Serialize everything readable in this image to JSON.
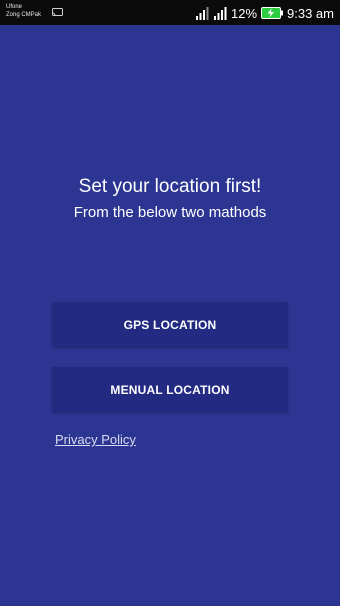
{
  "status_bar": {
    "carrier_line1": "Ufone",
    "carrier_line2": "Zong CMPak",
    "battery_percent": "12%",
    "time": "9:33 am",
    "icons": [
      "cast-icon",
      "signal-icon",
      "signal-icon",
      "battery-charging-icon"
    ]
  },
  "main": {
    "headline": "Set your location first!",
    "subline": "From the below two mathods",
    "gps_button_label": "GPS LOCATION",
    "manual_button_label": "MENUAL LOCATION",
    "privacy_link": "Privacy Policy"
  },
  "colors": {
    "background": "#2c3592",
    "button": "#232a82",
    "status_bar": "#0b0b0b",
    "battery_charge": "#2ecc40"
  }
}
